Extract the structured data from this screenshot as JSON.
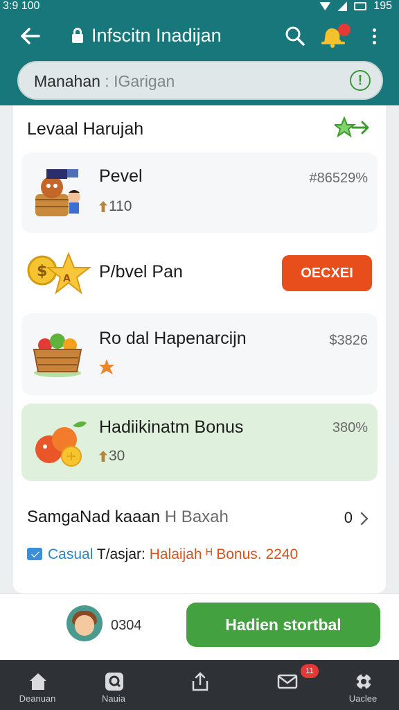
{
  "status_bar": {
    "time": "3:9 100",
    "battery": "195"
  },
  "header": {
    "title": "Infscitn Inadijan",
    "notification_badge": "",
    "icons": [
      "back-arrow-icon",
      "lock-icon",
      "search-icon",
      "bell-icon",
      "more-vert-icon"
    ]
  },
  "search": {
    "lead": "Manahan",
    "tail": " : IGarigan",
    "info_icon": "info-icon"
  },
  "section": {
    "title": "Levaal Harujah",
    "action_icon": "star-arrow-icon"
  },
  "rows": [
    {
      "name": "Pevel",
      "sub": "110",
      "value": "#86529%"
    },
    {
      "name": "P/bvel Pan",
      "button": "OECXEI"
    },
    {
      "name": "Ro dal Hapenarcijn",
      "value": "$3826"
    },
    {
      "name": "Hadiikinatm Bonus",
      "sub": "30",
      "value": "380%"
    }
  ],
  "summary": {
    "title_bold": "SamgaNad kaaan",
    "title_gray": " H Baxah",
    "count": "0"
  },
  "promo": {
    "tag": "Casual",
    "mid": " T/asjar: ",
    "highlight": "Halaijah ᴴ Bonus. 2240"
  },
  "footer": {
    "score": "0304",
    "cta": "Hadien stortbal"
  },
  "nav": {
    "items": [
      {
        "label": "Deanuan",
        "icon": "home-icon"
      },
      {
        "label": "Nauia",
        "icon": "game-icon"
      },
      {
        "label": "",
        "icon": "share-icon"
      },
      {
        "label": "",
        "icon": "mail-icon"
      },
      {
        "label": "Uaclee",
        "icon": "gear-icon"
      }
    ],
    "mail_badge": "11"
  },
  "colors": {
    "primary": "#17777a",
    "accent_orange": "#e84d1c",
    "accent_green": "#43a13f",
    "nav_bg": "#2e3135"
  }
}
